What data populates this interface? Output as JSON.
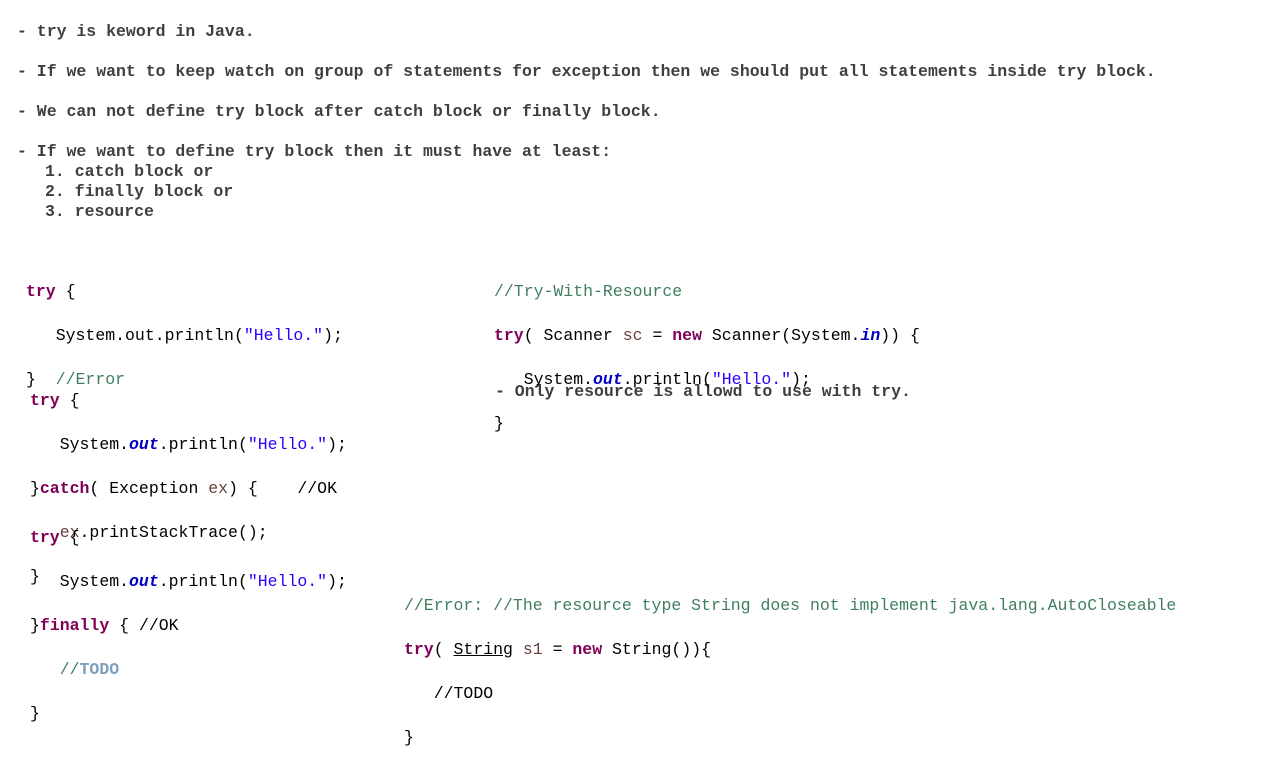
{
  "notes": {
    "n1": "- try is keword in Java.",
    "n2": "- If we want to keep watch on group of statements for exception then we should put all statements inside try block.",
    "n3": "- We can not define try block after catch block or finally block.",
    "n4": "- If we want to define try block then it must have at least:",
    "items": [
      "1. catch block or",
      "2. finally block or",
      "3. resource"
    ],
    "n5": "- Only resource is allowd to use with try."
  },
  "code": {
    "try": "try",
    "catch": "catch",
    "finally": "finally",
    "new": "new",
    "open_brace": " {",
    "close_brace": "}",
    "indent": "   ",
    "system": "System.",
    "out_plain": "System.out.println(",
    "out": "out",
    "println": ".println(",
    "hello": "\"Hello.\"",
    "end_call": ");",
    "error_comment": "//Error",
    "ok_comment": "//OK",
    "catch_open": "( Exception ",
    "ex": "ex",
    "catch_close": ") {    ",
    "print_stack": ".printStackTrace();",
    "finally_open": " { ",
    "todo_prefix": "//",
    "todo": "TODO",
    "todo_plain": "//TODO",
    "twr_comment": "//Try-With-Resource",
    "scanner_decl": "( Scanner ",
    "sc": "sc",
    "eq": " = ",
    "scanner_ctor": " Scanner(System.",
    "in": "in",
    "scanner_end": ")) {",
    "error_string_comment": "//Error: //The resource type String does not implement java.lang.AutoCloseable",
    "string_open": "( ",
    "string_type": "String",
    "s1": "s1",
    "string_ctor": " String()){"
  }
}
